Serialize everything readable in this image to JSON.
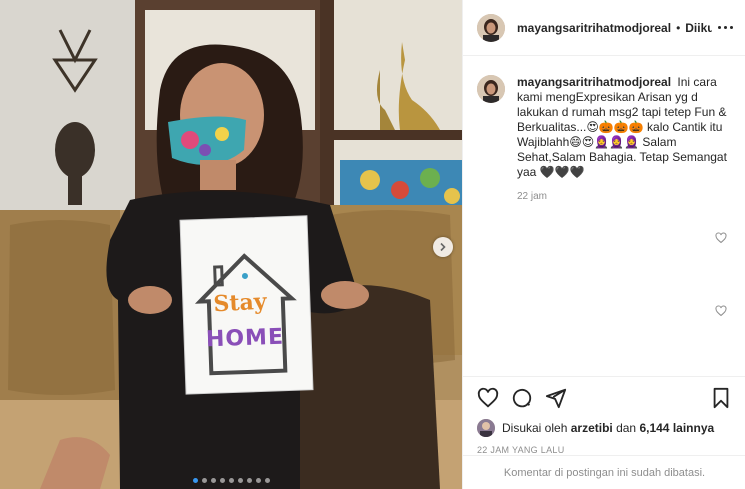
{
  "post": {
    "username": "mayangsaritrihatmodjoreal",
    "header_username": "mayangsaritrihatmodjoreal",
    "separator": "•",
    "follow_state": "Diikuti",
    "sign_word_top": "Stay",
    "sign_word_bottom": "HOME",
    "image_index": 1,
    "image_count": 9
  },
  "caption": {
    "username": "mayangsaritrihatmodjoreal",
    "text": "Ini cara kami mengExpresikan Arisan yg d lakukan d rumah msg2 tapi tetep Fun & Berkualitas...😍🎃🎃🎃 kalo Cantik itu Wajiblahh😄😍🧕🧕🧕 Salam Sehat,Salam Bahagia. Tetap Semangat yaa 🖤🖤🖤",
    "time": "22 jam"
  },
  "likes": {
    "prefix": "Disukai oleh",
    "user": "arzetibi",
    "connector": "dan",
    "count": "6,144 lainnya"
  },
  "post_date": "22 JAM YANG LALU",
  "footer": {
    "comments_disabled": "Komentar di postingan ini sudah dibatasi."
  },
  "icons": {
    "like": "heart-icon",
    "comment": "comment-icon",
    "share": "share-icon",
    "save": "bookmark-icon",
    "more": "more-options-icon",
    "next": "chevron-right-icon"
  },
  "colors": {
    "accent": "#3897f0",
    "text": "#262626",
    "muted": "#8e8e8e",
    "border": "#efefef"
  }
}
